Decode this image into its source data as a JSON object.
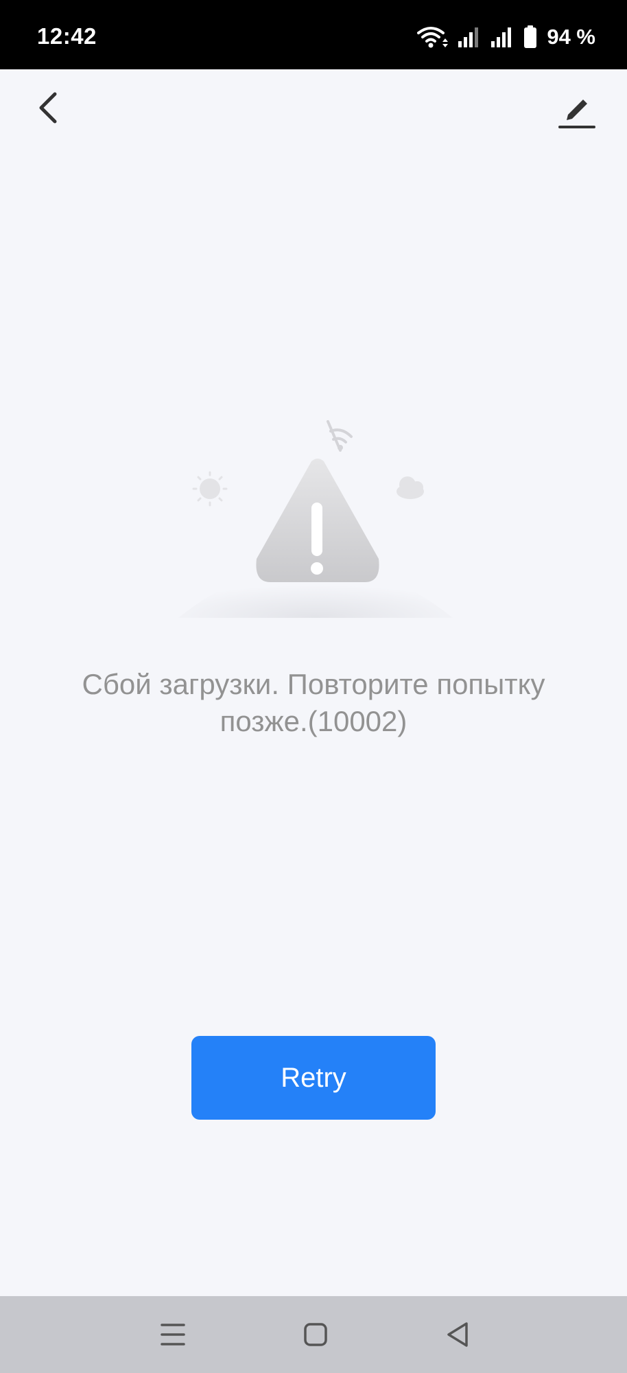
{
  "status_bar": {
    "time": "12:42",
    "battery_percent": "94 %",
    "icons": [
      "wifi-icon",
      "signal-icon",
      "signal-icon",
      "battery-icon"
    ]
  },
  "top_bar": {
    "back_icon": "chevron-left-icon",
    "edit_icon": "pencil-icon"
  },
  "error": {
    "illustration": "warning-triangle-illustration",
    "message": "Сбой загрузки. Повторите попытку позже.(10002)"
  },
  "actions": {
    "retry_label": "Retry"
  },
  "nav_bar": {
    "items": [
      "menu-icon",
      "home-icon",
      "back-icon"
    ]
  },
  "colors": {
    "background": "#f5f6fa",
    "accent": "#2481f8",
    "message_text": "#929292",
    "status_bar": "#000000",
    "nav_bar": "#c6c7cc"
  }
}
